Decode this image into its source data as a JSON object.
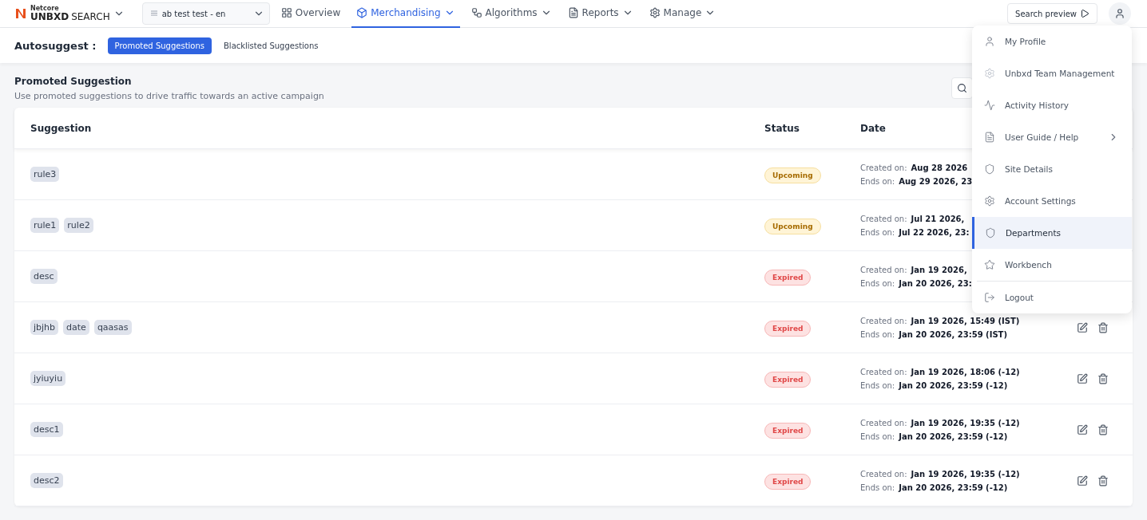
{
  "brand": {
    "small": "Netcore",
    "name": "UNBXD",
    "product": "SEARCH"
  },
  "site_selector": {
    "value": "ab test test - en"
  },
  "nav": [
    {
      "label": "Overview",
      "selected": false,
      "has_caret": false
    },
    {
      "label": "Merchandising",
      "selected": true,
      "has_caret": true
    },
    {
      "label": "Algorithms",
      "selected": false,
      "has_caret": true
    },
    {
      "label": "Reports",
      "selected": false,
      "has_caret": true
    },
    {
      "label": "Manage",
      "selected": false,
      "has_caret": true
    }
  ],
  "search_preview": "Search preview",
  "subnav": {
    "label": "Autosuggest :",
    "tabs": [
      {
        "label": "Promoted Suggestions",
        "selected": true
      },
      {
        "label": "Blacklisted Suggestions",
        "selected": false
      }
    ]
  },
  "section": {
    "title": "Promoted Suggestion",
    "subtitle": "Use promoted suggestions to drive traffic towards an active campaign"
  },
  "table": {
    "columns": [
      "Suggestion",
      "Status",
      "Date"
    ],
    "rows": [
      {
        "tags": [
          "rule3"
        ],
        "status": "Upcoming",
        "kind": "upcoming",
        "created_label": "Created on:",
        "created": "Aug 28 2026",
        "ends_label": "Ends on:",
        "ends": "Aug 29 2026, 23",
        "actions": false
      },
      {
        "tags": [
          "rule1",
          "rule2"
        ],
        "status": "Upcoming",
        "kind": "upcoming",
        "created_label": "Created on:",
        "created": "Jul 21 2026,",
        "ends_label": "Ends on:",
        "ends": "Jul 22 2026, 23:",
        "actions": false
      },
      {
        "tags": [
          "desc"
        ],
        "status": "Expired",
        "kind": "expired",
        "created_label": "Created on:",
        "created": "Jan 19 2026,",
        "ends_label": "Ends on:",
        "ends": "Jan 20 2026, 23:",
        "actions": false
      },
      {
        "tags": [
          "jbjhb",
          "date",
          "qaasas"
        ],
        "status": "Expired",
        "kind": "expired",
        "created_label": "Created on:",
        "created": "Jan 19 2026, 15:49 (IST)",
        "ends_label": "Ends on:",
        "ends": "Jan 20 2026, 23:59 (IST)",
        "actions": true
      },
      {
        "tags": [
          "jyiuyiu"
        ],
        "status": "Expired",
        "kind": "expired",
        "created_label": "Created on:",
        "created": "Jan 19 2026, 18:06 (-12)",
        "ends_label": "Ends on:",
        "ends": "Jan 20 2026, 23:59 (-12)",
        "actions": true
      },
      {
        "tags": [
          "desc1"
        ],
        "status": "Expired",
        "kind": "expired",
        "created_label": "Created on:",
        "created": "Jan 19 2026, 19:35 (-12)",
        "ends_label": "Ends on:",
        "ends": "Jan 20 2026, 23:59 (-12)",
        "actions": true
      },
      {
        "tags": [
          "desc2"
        ],
        "status": "Expired",
        "kind": "expired",
        "created_label": "Created on:",
        "created": "Jan 19 2026, 19:35 (-12)",
        "ends_label": "Ends on:",
        "ends": "Jan 20 2026, 23:59 (-12)",
        "actions": true
      }
    ]
  },
  "user_menu": {
    "items": [
      {
        "label": "My Profile",
        "selected": false,
        "submenu": false,
        "divider_before": false
      },
      {
        "label": "Unbxd Team Management",
        "selected": false,
        "submenu": false,
        "divider_before": false
      },
      {
        "label": "Activity History",
        "selected": false,
        "submenu": false,
        "divider_before": false
      },
      {
        "label": "User Guide / Help",
        "selected": false,
        "submenu": true,
        "divider_before": false
      },
      {
        "label": "Site Details",
        "selected": false,
        "submenu": false,
        "divider_before": false
      },
      {
        "label": "Account Settings",
        "selected": false,
        "submenu": false,
        "divider_before": false
      },
      {
        "label": "Departments",
        "selected": true,
        "submenu": false,
        "divider_before": false
      },
      {
        "label": "Workbench",
        "selected": false,
        "submenu": false,
        "divider_before": false
      },
      {
        "label": "Logout",
        "selected": false,
        "submenu": false,
        "divider_before": true
      }
    ]
  }
}
